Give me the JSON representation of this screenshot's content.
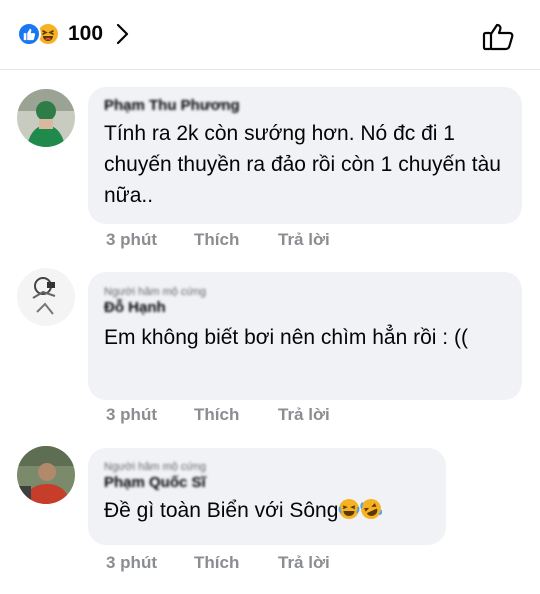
{
  "reactions": {
    "count": "100",
    "types": [
      "like-icon",
      "haha-icon"
    ]
  },
  "colors": {
    "like_blue": "#1877f2",
    "haha_yellow": "#f7b125",
    "bubble_bg": "#f0f2f5",
    "meta_gray": "#8a8d91"
  },
  "comments": [
    {
      "name": "Phạm Thu Phương",
      "text": "Tính ra 2k còn sướng hơn. Nó đc đi  1 chuyến thuyền ra đảo rồi còn 1 chuyến tàu nữa..",
      "time": "3 phút",
      "like": "Thích",
      "reply": "Trả lời"
    },
    {
      "badge": "Người hâm mộ cứng",
      "name": "Đỗ Hạnh",
      "text": "Em không biết bơi nên chìm hẳn rồi : ((",
      "time": "3 phút",
      "like": "Thích",
      "reply": "Trả lời"
    },
    {
      "badge": "Người hâm mộ cứng",
      "name": "Phạm Quốc Sĩ",
      "text": "Đề gì toàn Biển với Sông",
      "emojis": [
        "crying-laughing-emoji",
        "rolling-laughing-emoji"
      ],
      "time": "3 phút",
      "like": "Thích",
      "reply": "Trả lời"
    }
  ]
}
